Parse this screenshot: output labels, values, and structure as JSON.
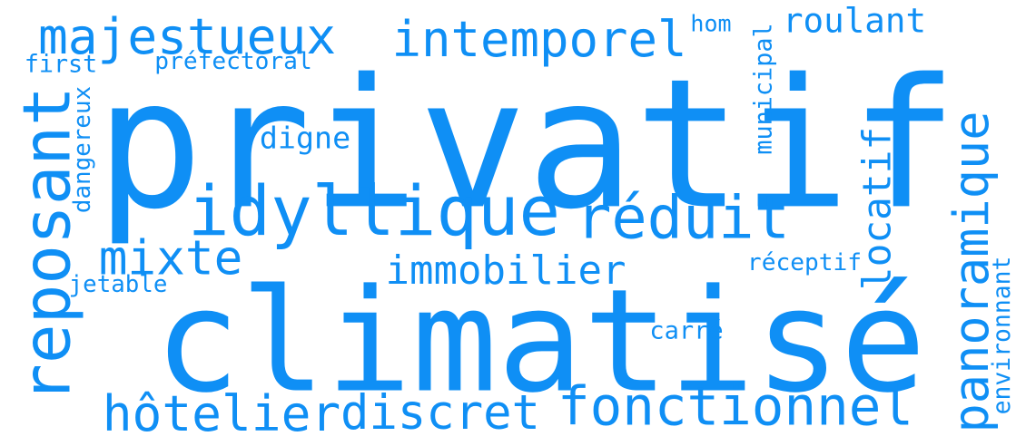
{
  "palette": {
    "word_color": "#0f8ff5",
    "background": "#ffffff"
  },
  "words": [
    {
      "text": "privatif",
      "orientation": "horizontal"
    },
    {
      "text": "climatisé",
      "orientation": "horizontal"
    },
    {
      "text": "idyllique",
      "orientation": "horizontal"
    },
    {
      "text": "réduit",
      "orientation": "horizontal"
    },
    {
      "text": "fonctionnel",
      "orientation": "horizontal"
    },
    {
      "text": "hôtelier",
      "orientation": "horizontal"
    },
    {
      "text": "discret",
      "orientation": "horizontal"
    },
    {
      "text": "majestueux",
      "orientation": "horizontal"
    },
    {
      "text": "intemporel",
      "orientation": "horizontal"
    },
    {
      "text": "roulant",
      "orientation": "horizontal"
    },
    {
      "text": "hom",
      "orientation": "horizontal"
    },
    {
      "text": "first",
      "orientation": "horizontal"
    },
    {
      "text": "préfectoral",
      "orientation": "horizontal"
    },
    {
      "text": "digne",
      "orientation": "horizontal"
    },
    {
      "text": "mixte",
      "orientation": "horizontal"
    },
    {
      "text": "immobilier",
      "orientation": "horizontal"
    },
    {
      "text": "jetable",
      "orientation": "horizontal"
    },
    {
      "text": "réceptif",
      "orientation": "horizontal"
    },
    {
      "text": "carré",
      "orientation": "horizontal"
    },
    {
      "text": "reposant",
      "orientation": "vertical"
    },
    {
      "text": "dangereux",
      "orientation": "vertical"
    },
    {
      "text": "municipal",
      "orientation": "vertical"
    },
    {
      "text": "locatif",
      "orientation": "vertical"
    },
    {
      "text": "panoramique",
      "orientation": "vertical"
    },
    {
      "text": "environnant",
      "orientation": "vertical"
    }
  ]
}
